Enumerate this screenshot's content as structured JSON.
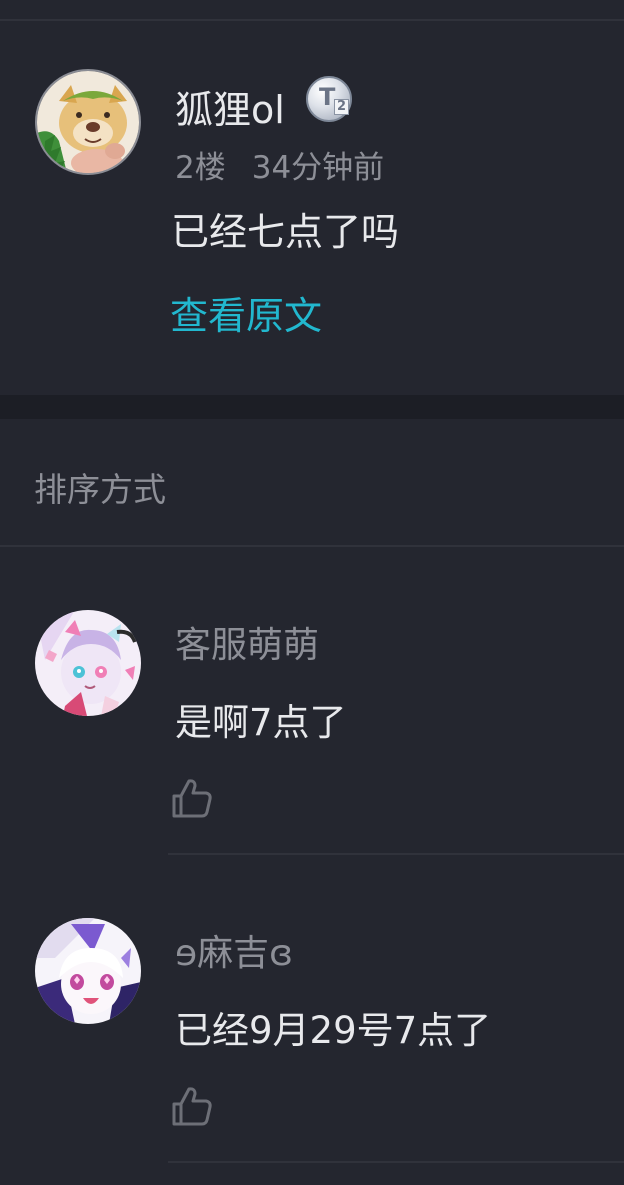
{
  "post": {
    "username": "狐狸ol",
    "badge_letter": "T",
    "badge_level": "2",
    "floor": "2楼",
    "time": "34分钟前",
    "content": "已经七点了吗",
    "view_original": "查看原文"
  },
  "sort": {
    "label": "排序方式"
  },
  "comments": [
    {
      "username": "客服萌萌",
      "content": "是啊7点了"
    },
    {
      "username": "ɘ麻吉ɞ",
      "content": "已经9月29号7点了"
    }
  ],
  "colors": {
    "background": "#24262f",
    "accent_link": "#22b8cf",
    "text_primary": "#e8e9ec",
    "text_secondary": "#8d8f97"
  }
}
